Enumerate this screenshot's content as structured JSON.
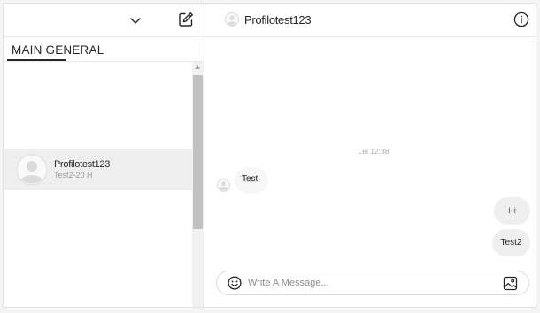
{
  "left_header": {
    "dropdown_icon": "chevron-down-icon",
    "compose_icon": "compose-icon"
  },
  "tabs": [
    {
      "label": "MAIN GENERAL"
    }
  ],
  "conversations": [
    {
      "name": "Profilotest123",
      "meta": "Test2-20 H",
      "selected": true
    }
  ],
  "chat": {
    "header_name": "Profilotest123",
    "info_icon": "info-icon",
    "timestamp": "Lei 12:38",
    "messages": [
      {
        "direction": "incoming",
        "text": "Test",
        "ghost_text": "Test"
      },
      {
        "direction": "outgoing",
        "text": "Hi"
      },
      {
        "direction": "outgoing",
        "text": "Test2"
      }
    ],
    "composer": {
      "placeholder": "Write A Message...",
      "emoji_icon": "emoji-icon",
      "image_icon": "image-icon"
    }
  },
  "colors": {
    "selected_row": "#efefef",
    "bubble": "#efefef",
    "border": "#dbdbdb",
    "text": "#262626",
    "muted": "#9a9a9a"
  }
}
